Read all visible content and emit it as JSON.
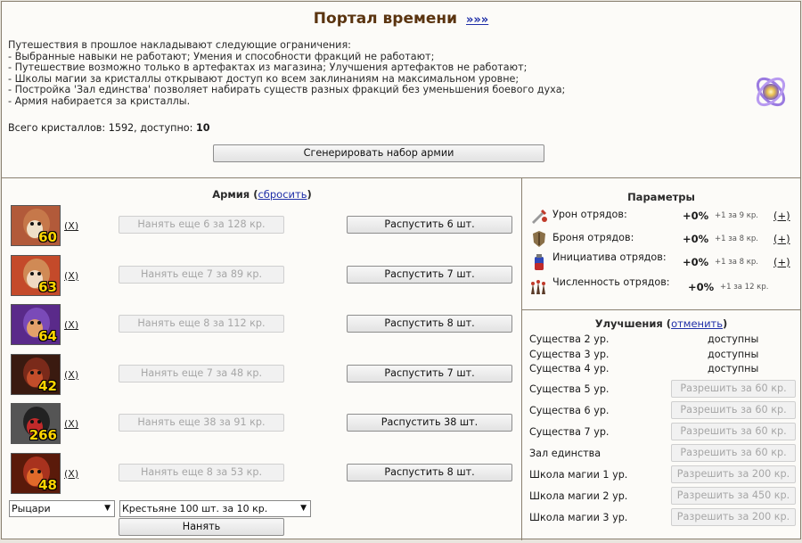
{
  "header": {
    "title": "Портал времени",
    "title_link": "»»»"
  },
  "intro": {
    "lines": [
      "Путешествия в прошлое накладывают следующие ограничения:",
      "- Выбранные навыки не работают; Умения и способности фракций не работают;",
      "- Путешествие возможно только в артефактах из магазина; Улучшения артефактов не работают;",
      "- Школы магии за кристаллы открывают доступ ко всем заклинаниям на максимальном уровне;",
      "- Постройка 'Зал единства' позволяет набирать существ разных фракций без уменьшения боевого духа;",
      "- Армия набирается за кристаллы."
    ],
    "crystals_text": "Всего кристаллов: 1592, доступно:",
    "crystals_available": "10"
  },
  "generate_button": "Сгенерировать набор армии",
  "army": {
    "title": "Армия",
    "reset_link": "сбросить",
    "units": [
      {
        "count": "60",
        "remove": "(X)",
        "hire": "Нанять еще 6 за 128 кр.",
        "dismiss": "Распустить 6 шт.",
        "colors": [
          "#c6784a",
          "#efe0c8",
          "#b25a3a"
        ]
      },
      {
        "count": "63",
        "remove": "(X)",
        "hire": "Нанять еще 7 за 89 кр.",
        "dismiss": "Распустить 7 шт.",
        "colors": [
          "#d08a55",
          "#f0d9c2",
          "#c44a2a"
        ]
      },
      {
        "count": "64",
        "remove": "(X)",
        "hire": "Нанять еще 8 за 112 кр.",
        "dismiss": "Распустить 8 шт.",
        "colors": [
          "#7a4ab8",
          "#e3a06a",
          "#5a2a8a"
        ]
      },
      {
        "count": "42",
        "remove": "(X)",
        "hire": "Нанять еще 7 за 48 кр.",
        "dismiss": "Распустить 7 шт.",
        "colors": [
          "#7a2a1a",
          "#c14d2a",
          "#3a1a10"
        ]
      },
      {
        "count": "266",
        "remove": "(X)",
        "hire": "Нанять еще 38 за 91 кр.",
        "dismiss": "Распустить 38 шт.",
        "colors": [
          "#222222",
          "#c02a2a",
          "#555555"
        ]
      },
      {
        "count": "48",
        "remove": "(X)",
        "hire": "Нанять еще 8 за 53 кр.",
        "dismiss": "Распустить 8 шт.",
        "colors": [
          "#a8321e",
          "#e06a2a",
          "#5a1a0a"
        ]
      }
    ],
    "faction_select": "Рыцари",
    "unit_select": "Крестьяне 100 шт. за 10 кр.",
    "hire_button": "Нанять"
  },
  "params": {
    "title": "Параметры",
    "rows": [
      {
        "icon": "sword-damage-icon",
        "label": "Урон отрядов:",
        "value": "+0%",
        "rate": "+1 за 9 кр.",
        "plus": "(+)"
      },
      {
        "icon": "armor-icon",
        "label": "Броня отрядов:",
        "value": "+0%",
        "rate": "+1 за 8 кр.",
        "plus": "(+)"
      },
      {
        "icon": "initiative-potion-icon",
        "label": "Инициатива отрядов:",
        "value": "+0%",
        "rate": "+1 за 8 кр.",
        "plus": "(+)"
      },
      {
        "icon": "troops-size-icon",
        "label": "Численность отрядов:",
        "value": "+0%",
        "rate": "+1 за 12 кр.",
        "plus": ""
      }
    ]
  },
  "upgrades": {
    "title": "Улучшения",
    "cancel_link": "отменить",
    "rows": [
      {
        "label": "Существа 2 ур.",
        "status": "доступны"
      },
      {
        "label": "Существа 3 ур.",
        "status": "доступны"
      },
      {
        "label": "Существа 4 ур.",
        "status": "доступны"
      },
      {
        "label": "Существа 5 ур.",
        "button": "Разрешить за 60 кр."
      },
      {
        "label": "Существа 6 ур.",
        "button": "Разрешить за 60 кр."
      },
      {
        "label": "Существа 7 ур.",
        "button": "Разрешить за 60 кр."
      },
      {
        "label": "Зал единства",
        "button": "Разрешить за 60 кр."
      },
      {
        "label": "Школа магии 1 ур.",
        "button": "Разрешить за 200 кр."
      },
      {
        "label": "Школа магии 2 ур.",
        "button": "Разрешить за 450 кр."
      },
      {
        "label": "Школа магии 3 ур.",
        "button": "Разрешить за 200 кр."
      }
    ]
  }
}
